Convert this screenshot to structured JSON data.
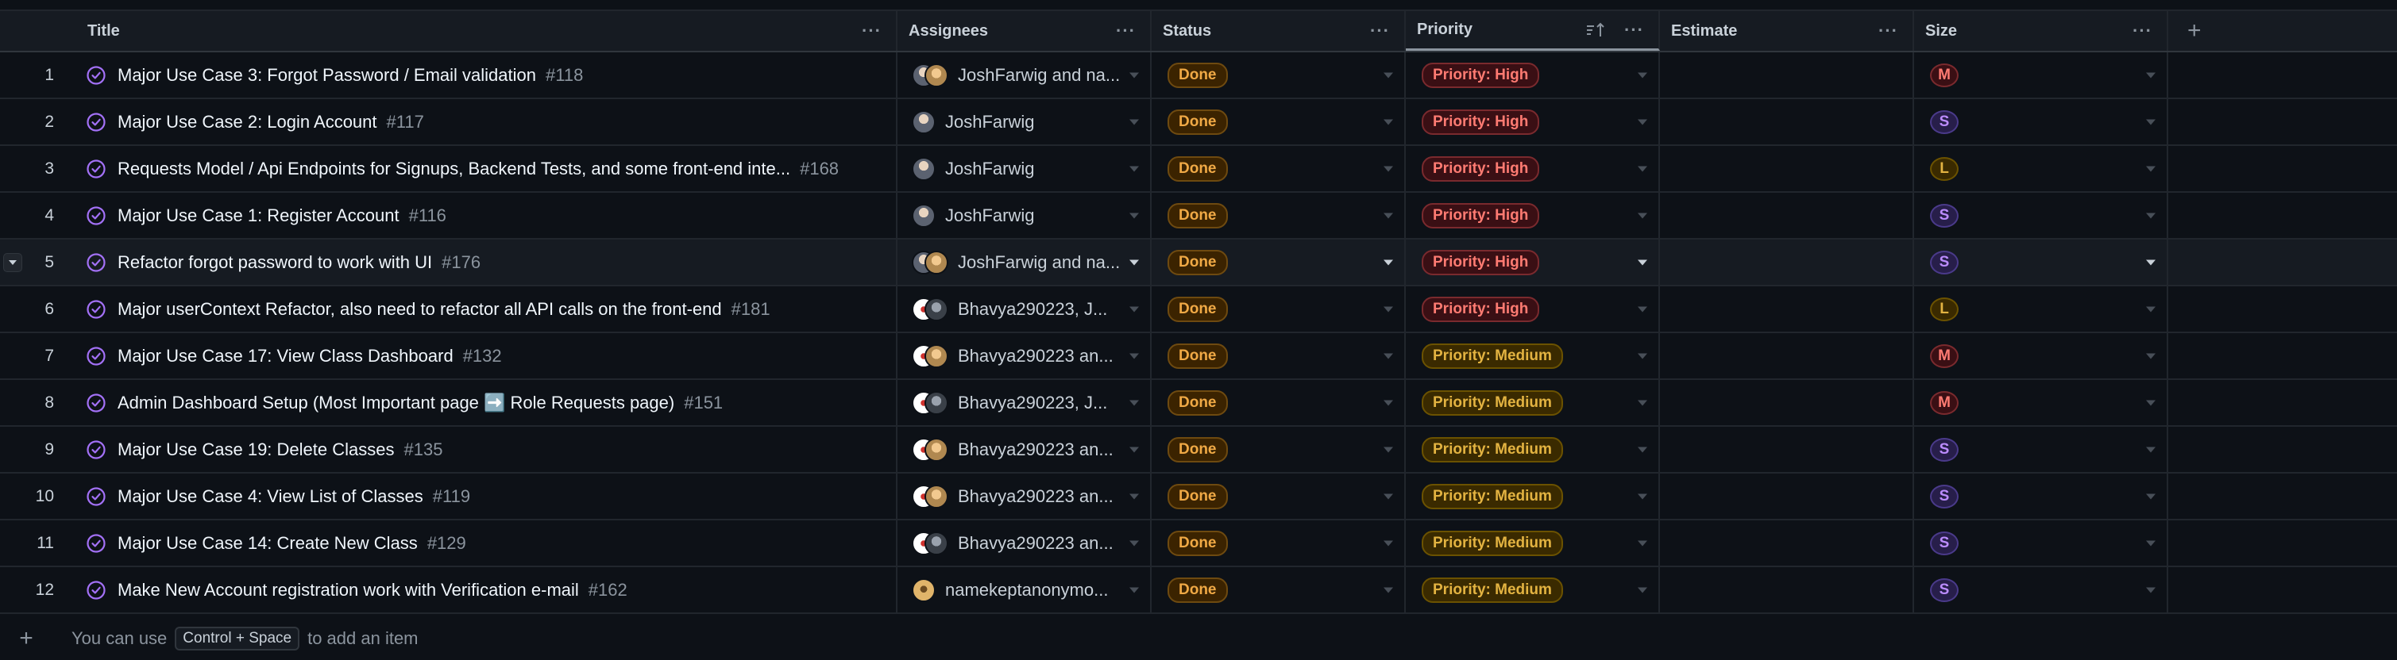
{
  "columns": {
    "title": "Title",
    "assignees": "Assignees",
    "status": "Status",
    "priority": "Priority",
    "estimate": "Estimate",
    "size": "Size"
  },
  "icons": {
    "more": "more-horizontal-icon",
    "sort": "sort-ascending-icon",
    "add_field": "plus-icon",
    "status": "issue-closed-icon",
    "caret": "chevron-down-icon"
  },
  "colors": {
    "background": "#0d1117",
    "header_background": "#161b22",
    "border": "#21262d",
    "done_accent": "#f0a945",
    "high_accent": "#ff7b72",
    "medium_accent": "#e3b341",
    "closed_icon": "#a371f7"
  },
  "rows": [
    {
      "index": "1",
      "title": "Major Use Case 3: Forgot Password / Email validation",
      "number": "#118",
      "assignees": "JoshFarwig and na...",
      "status": "Done",
      "priority": "Priority: High",
      "estimate": "",
      "size": "M"
    },
    {
      "index": "2",
      "title": "Major Use Case 2: Login Account",
      "number": "#117",
      "assignees": "JoshFarwig",
      "status": "Done",
      "priority": "Priority: High",
      "estimate": "",
      "size": "S"
    },
    {
      "index": "3",
      "title": "Requests Model / Api Endpoints for Signups, Backend Tests, and some front-end inte...",
      "number": "#168",
      "assignees": "JoshFarwig",
      "status": "Done",
      "priority": "Priority: High",
      "estimate": "",
      "size": "L"
    },
    {
      "index": "4",
      "title": "Major Use Case 1: Register Account",
      "number": "#116",
      "assignees": "JoshFarwig",
      "status": "Done",
      "priority": "Priority: High",
      "estimate": "",
      "size": "S"
    },
    {
      "index": "5",
      "title": "Refactor forgot password to work with UI",
      "number": "#176",
      "assignees": "JoshFarwig and na...",
      "status": "Done",
      "priority": "Priority: High",
      "estimate": "",
      "size": "S"
    },
    {
      "index": "6",
      "title": "Major userContext Refactor, also need to refactor all API calls on the front-end",
      "number": "#181",
      "assignees": "Bhavya290223, J...",
      "status": "Done",
      "priority": "Priority: High",
      "estimate": "",
      "size": "L"
    },
    {
      "index": "7",
      "title": "Major Use Case 17: View Class Dashboard",
      "number": "#132",
      "assignees": "Bhavya290223 an...",
      "status": "Done",
      "priority": "Priority: Medium",
      "estimate": "",
      "size": "M"
    },
    {
      "index": "8",
      "title": "Admin Dashboard Setup (Most Important page ➡️ Role Requests page)",
      "number": "#151",
      "assignees": "Bhavya290223, J...",
      "status": "Done",
      "priority": "Priority: Medium",
      "estimate": "",
      "size": "M"
    },
    {
      "index": "9",
      "title": "Major Use Case 19: Delete Classes",
      "number": "#135",
      "assignees": "Bhavya290223 an...",
      "status": "Done",
      "priority": "Priority: Medium",
      "estimate": "",
      "size": "S"
    },
    {
      "index": "10",
      "title": "Major Use Case 4: View List of Classes",
      "number": "#119",
      "assignees": "Bhavya290223 an...",
      "status": "Done",
      "priority": "Priority: Medium",
      "estimate": "",
      "size": "S"
    },
    {
      "index": "11",
      "title": "Major Use Case 14: Create New Class",
      "number": "#129",
      "assignees": "Bhavya290223 an...",
      "status": "Done",
      "priority": "Priority: Medium",
      "estimate": "",
      "size": "S"
    },
    {
      "index": "12",
      "title": "Make New Account registration work with Verification e-mail",
      "number": "#162",
      "assignees": "namekeptanonymo...",
      "status": "Done",
      "priority": "Priority: Medium",
      "estimate": "",
      "size": "S"
    }
  ],
  "footer": {
    "prefix": "You can use",
    "shortcut": "Control + Space",
    "suffix": "to add an item"
  }
}
